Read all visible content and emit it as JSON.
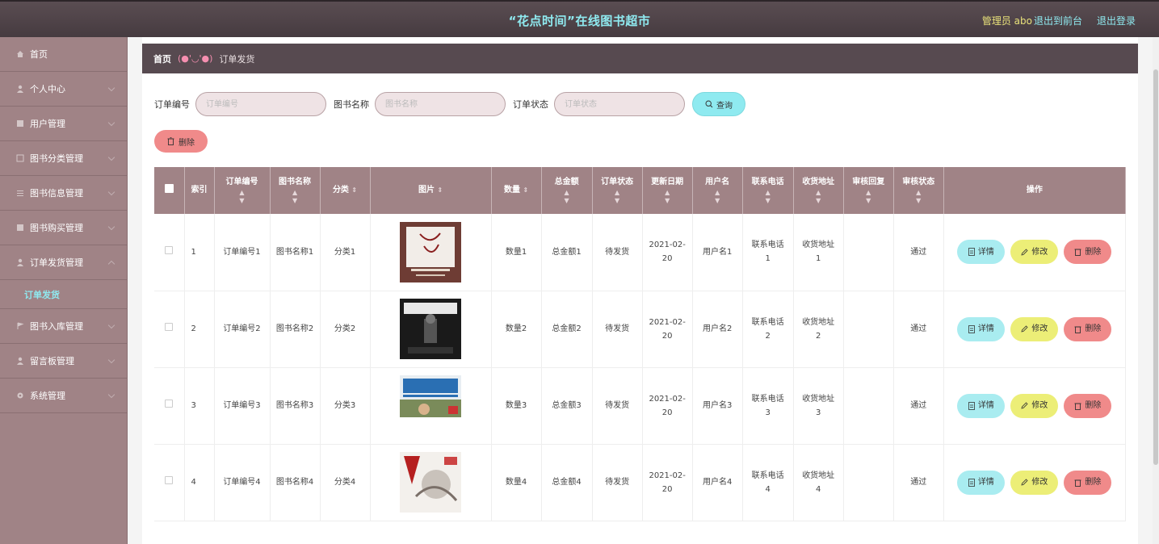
{
  "header": {
    "title": "“花点时间”在线图书超市",
    "admin": "管理员 abo",
    "back_to_front": "退出到前台",
    "logout": "退出登录"
  },
  "sidebar": {
    "items": [
      {
        "label": "首页",
        "icon": "home-icon"
      },
      {
        "label": "个人中心",
        "icon": "user-icon"
      },
      {
        "label": "用户管理",
        "icon": "grid-icon"
      },
      {
        "label": "图书分类管理",
        "icon": "grid-icon"
      },
      {
        "label": "图书信息管理",
        "icon": "list-icon"
      },
      {
        "label": "图书购买管理",
        "icon": "grid-icon"
      },
      {
        "label": "订单发货管理",
        "icon": "user-icon"
      },
      {
        "label": "图书入库管理",
        "icon": "flag-icon"
      },
      {
        "label": "留言板管理",
        "icon": "user-icon"
      },
      {
        "label": "系统管理",
        "icon": "gear-icon"
      }
    ],
    "active_sub": "订单发货"
  },
  "breadcrumb": {
    "home": "首页",
    "face": "(●'◡'●)",
    "current": "订单发货"
  },
  "search": {
    "order_label": "订单编号",
    "order_placeholder": "订单编号",
    "book_label": "图书名称",
    "book_placeholder": "图书名称",
    "status_label": "订单状态",
    "status_placeholder": "订单状态",
    "query_button": "查询"
  },
  "delete_button": "删除",
  "table": {
    "headers": [
      "索引",
      "订单编号",
      "图书名称",
      "分类",
      "图片",
      "数量",
      "总金额",
      "订单状态",
      "更新日期",
      "用户名",
      "联系电话",
      "收货地址",
      "审核回复",
      "审核状态",
      "操作"
    ],
    "rows": [
      {
        "index": "1",
        "order_no": "订单编号1",
        "book": "图书名称1",
        "category": "分类1",
        "qty": "数量1",
        "total": "总金额1",
        "status": "待发货",
        "date": "2021-02-20",
        "user": "用户名1",
        "phone": "联系电话1",
        "address": "收货地址1",
        "reply": "",
        "audit": "通过",
        "cover": "cover-1"
      },
      {
        "index": "2",
        "order_no": "订单编号2",
        "book": "图书名称2",
        "category": "分类2",
        "qty": "数量2",
        "total": "总金额2",
        "status": "待发货",
        "date": "2021-02-20",
        "user": "用户名2",
        "phone": "联系电话2",
        "address": "收货地址2",
        "reply": "",
        "audit": "通过",
        "cover": "cover-2"
      },
      {
        "index": "3",
        "order_no": "订单编号3",
        "book": "图书名称3",
        "category": "分类3",
        "qty": "数量3",
        "total": "总金额3",
        "status": "待发货",
        "date": "2021-02-20",
        "user": "用户名3",
        "phone": "联系电话3",
        "address": "收货地址3",
        "reply": "",
        "audit": "通过",
        "cover": "cover-3"
      },
      {
        "index": "4",
        "order_no": "订单编号4",
        "book": "图书名称4",
        "category": "分类4",
        "qty": "数量4",
        "total": "总金额4",
        "status": "待发货",
        "date": "2021-02-20",
        "user": "用户名4",
        "phone": "联系电话4",
        "address": "收货地址4",
        "reply": "",
        "audit": "通过",
        "cover": "cover-4"
      }
    ],
    "ops": {
      "detail": "详情",
      "edit": "修改",
      "delete": "删除"
    }
  },
  "colors": {
    "topbar": "#4f4348",
    "sidebar": "#a08386",
    "accent_cyan": "#8feaf0",
    "accent_yellow": "#ecee77",
    "accent_red": "#f08a8a"
  }
}
